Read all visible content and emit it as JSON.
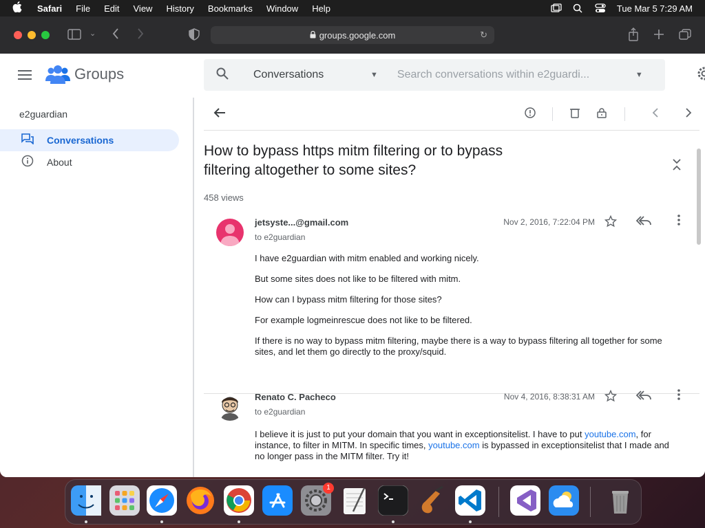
{
  "menubar": {
    "app": "Safari",
    "items": [
      "File",
      "Edit",
      "View",
      "History",
      "Bookmarks",
      "Window",
      "Help"
    ],
    "datetime": "Tue Mar 5  7:29 AM"
  },
  "browser": {
    "url": "groups.google.com"
  },
  "sidebar": {
    "brand": "Groups",
    "group_name": "e2guardian",
    "items": [
      {
        "label": "Conversations",
        "active": true
      },
      {
        "label": "About",
        "active": false
      }
    ]
  },
  "search": {
    "scope": "Conversations",
    "placeholder": "Search conversations within e2guardi..."
  },
  "thread": {
    "title": "How to bypass https mitm filtering or to bypass filtering altogether to some sites?",
    "views": "458 views"
  },
  "messages": [
    {
      "author": "jetsyste...@gmail.com",
      "to": "to e2guardian",
      "date": "Nov 2, 2016, 7:22:04 PM",
      "paragraphs": [
        "I have e2guardian with mitm enabled and working nicely.",
        "But some sites does not like to be filtered with mitm.",
        "How can I bypass mitm filtering for those sites?",
        "For example logmeinrescue does not like to be filtered.",
        "If there is no way to bypass mitm filtering, maybe there is a way to bypass filtering all together for some sites, and let them go directly to the proxy/squid."
      ]
    },
    {
      "author": "Renato C. Pacheco",
      "to": "to e2guardian",
      "date": "Nov 4, 2016, 8:38:31 AM",
      "p1": "I believe it is just to put your domain that you want in exceptionsitelist. I have to put ",
      "link1": "youtube.com",
      "p2": ", for instance, to filter in MITM. In specific times, ",
      "link2": "youtube.com",
      "p3": " is bypassed in exceptionsitelist that I made and no longer pass in the MITM filter. Try it!"
    }
  ],
  "dock": {
    "settings_badge": "1"
  },
  "colors": {
    "accent": "#1967d2",
    "active_bg": "#e8f0fe",
    "link": "#1a73e8"
  }
}
